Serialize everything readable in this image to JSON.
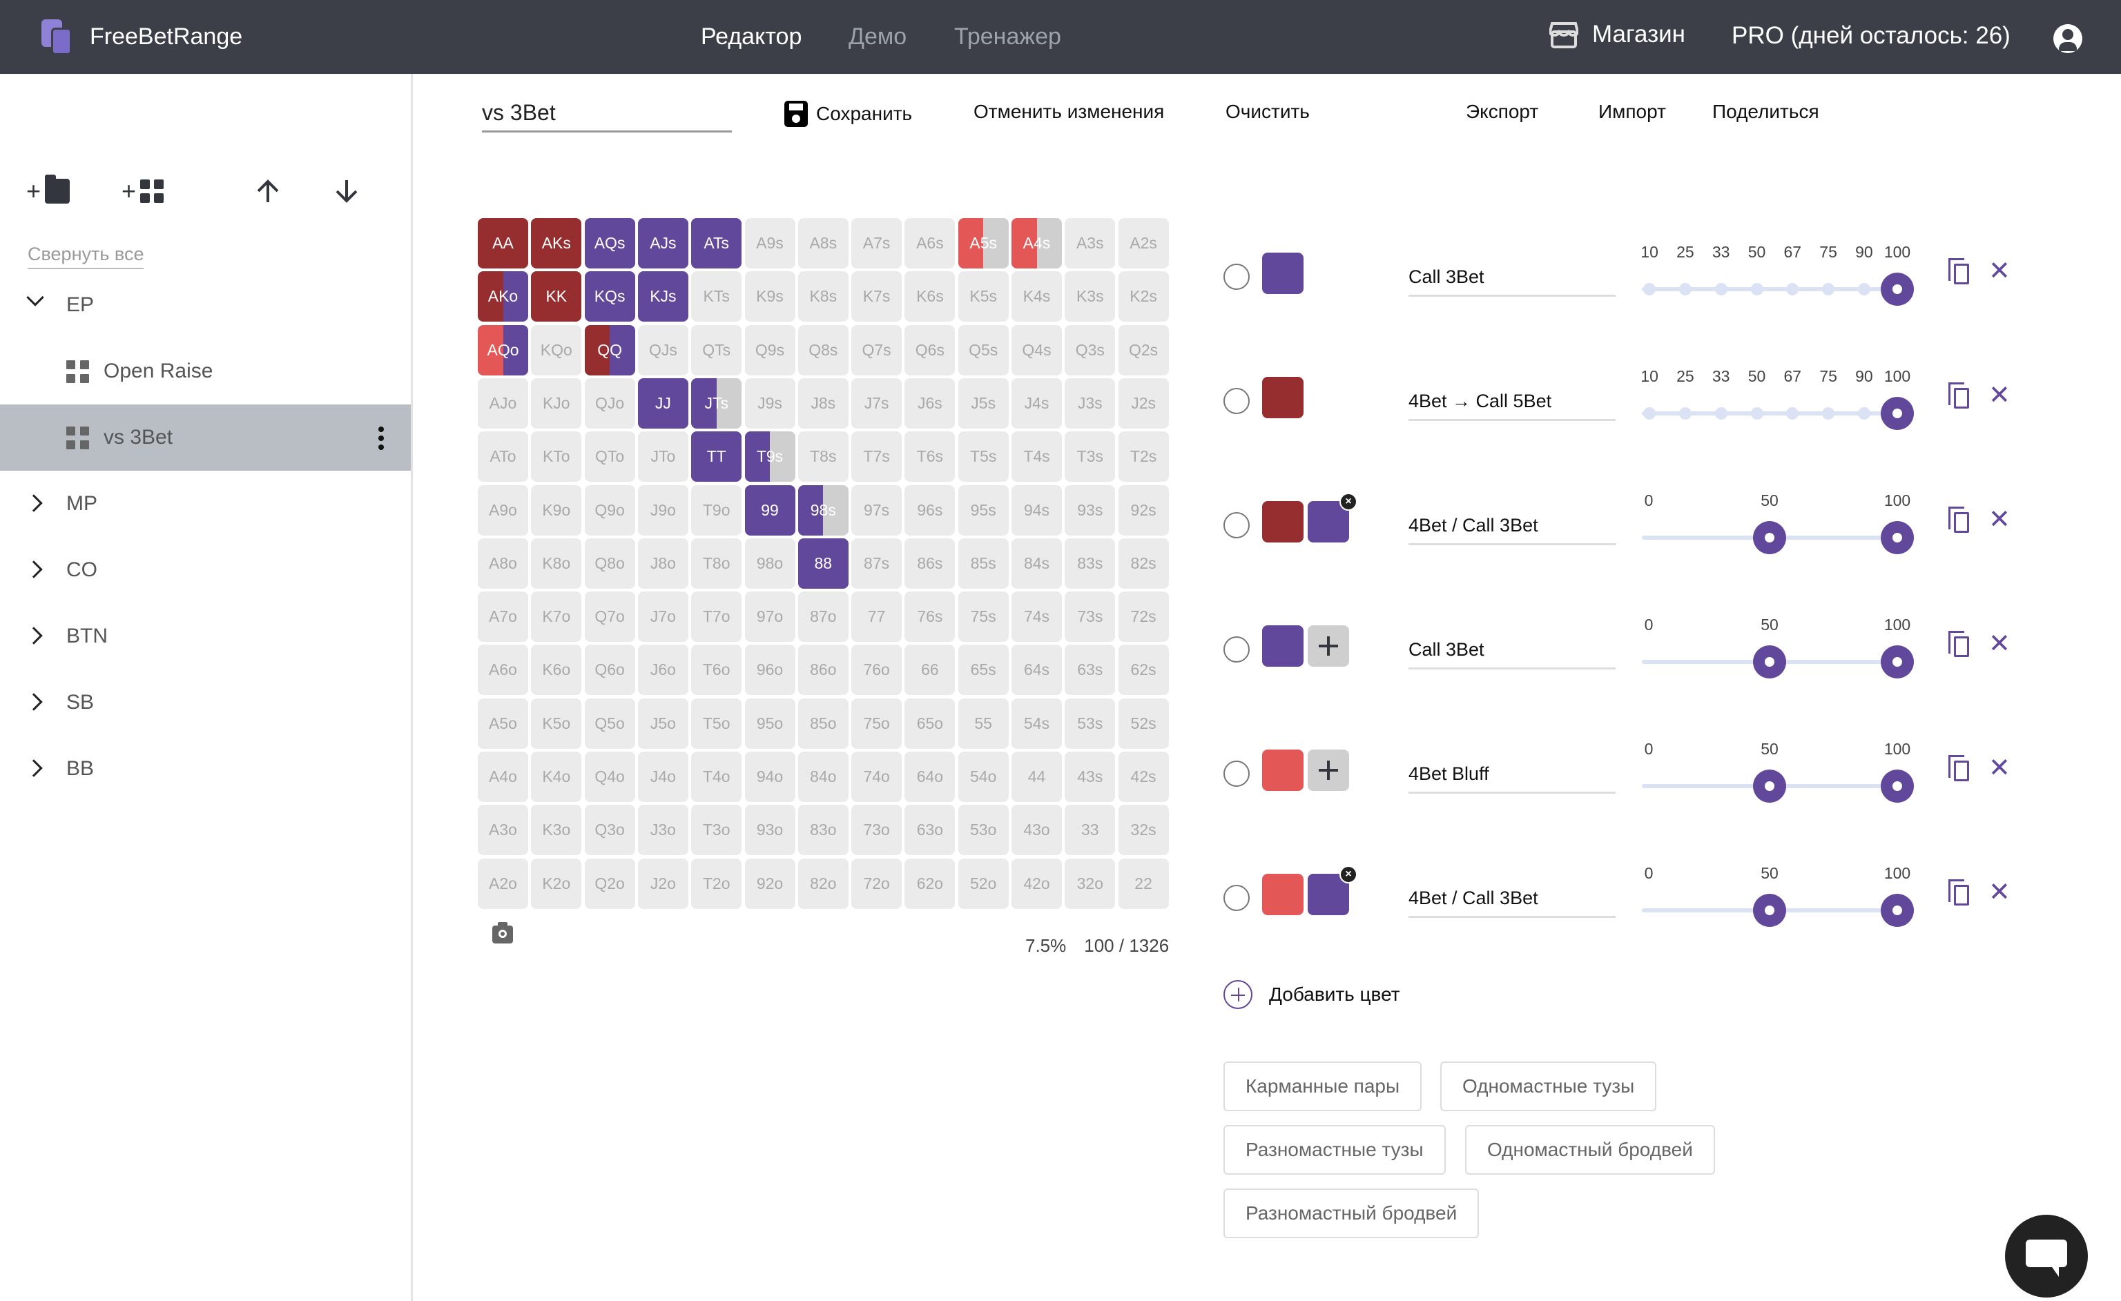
{
  "header": {
    "brand": "FreeBetRange",
    "nav": [
      {
        "label": "Редактор",
        "active": true
      },
      {
        "label": "Демо",
        "active": false
      },
      {
        "label": "Тренажер",
        "active": false
      }
    ],
    "shop_label": "Магазин",
    "pro_label": "PRO (дней осталось: 26)"
  },
  "sidebar": {
    "tools": {
      "add_folder": "+",
      "add_range": "+"
    },
    "collapse_all": "Свернуть все",
    "tree": [
      {
        "label": "EP",
        "expanded": true,
        "children": [
          {
            "label": "Open Raise",
            "selected": false
          },
          {
            "label": "vs 3Bet",
            "selected": true
          }
        ]
      },
      {
        "label": "MP",
        "expanded": false
      },
      {
        "label": "CO",
        "expanded": false
      },
      {
        "label": "BTN",
        "expanded": false
      },
      {
        "label": "SB",
        "expanded": false
      },
      {
        "label": "BB",
        "expanded": false
      }
    ]
  },
  "toolbar": {
    "range_name": "vs 3Bet",
    "save": "Сохранить",
    "revert": "Отменить изменения",
    "clear": "Очистить",
    "export": "Экспорт",
    "import": "Импорт",
    "share": "Поделиться"
  },
  "colors": {
    "purple": "#61489b",
    "darkred": "#962d2f",
    "red": "#e45757",
    "empty": "#ebebeb",
    "partial": "#cfcfcf"
  },
  "grid": {
    "ranks": [
      "A",
      "K",
      "Q",
      "J",
      "T",
      "9",
      "8",
      "7",
      "6",
      "5",
      "4",
      "3",
      "2"
    ],
    "highlighted": {
      "AA": [
        [
          "darkred",
          1
        ]
      ],
      "AKs": [
        [
          "darkred",
          1
        ]
      ],
      "AQs": [
        [
          "purple",
          1
        ]
      ],
      "AJs": [
        [
          "purple",
          1
        ]
      ],
      "ATs": [
        [
          "purple",
          1
        ]
      ],
      "A5s": [
        [
          "red",
          0.5
        ],
        [
          "partial",
          0.5
        ]
      ],
      "A4s": [
        [
          "red",
          0.5
        ],
        [
          "partial",
          0.5
        ]
      ],
      "AKo": [
        [
          "darkred",
          0.5
        ],
        [
          "purple",
          0.5
        ]
      ],
      "KK": [
        [
          "darkred",
          1
        ]
      ],
      "KQs": [
        [
          "purple",
          1
        ]
      ],
      "KJs": [
        [
          "purple",
          1
        ]
      ],
      "AQo": [
        [
          "red",
          0.5
        ],
        [
          "purple",
          0.5
        ]
      ],
      "QQ": [
        [
          "darkred",
          0.5
        ],
        [
          "purple",
          0.5
        ]
      ],
      "JJ": [
        [
          "purple",
          1
        ]
      ],
      "JTs": [
        [
          "purple",
          0.5
        ],
        [
          "partial",
          0.5
        ]
      ],
      "TT": [
        [
          "purple",
          1
        ]
      ],
      "T9s": [
        [
          "purple",
          0.5
        ],
        [
          "partial",
          0.5
        ]
      ],
      "99": [
        [
          "purple",
          1
        ]
      ],
      "98s": [
        [
          "purple",
          0.5
        ],
        [
          "partial",
          0.5
        ]
      ],
      "88": [
        [
          "purple",
          1
        ]
      ]
    }
  },
  "stats": {
    "percent": "7.5%",
    "combos": "100 / 1326"
  },
  "color_rows": [
    {
      "swatches": [
        "purple"
      ],
      "add": false,
      "name": "Call 3Bet",
      "slider": {
        "type": "steps",
        "labels": [
          "10",
          "25",
          "33",
          "50",
          "67",
          "75",
          "90",
          "100"
        ],
        "values": [
          100
        ]
      }
    },
    {
      "swatches": [
        "darkred"
      ],
      "add": false,
      "name": "4Bet → Call 5Bet",
      "slider": {
        "type": "steps",
        "labels": [
          "10",
          "25",
          "33",
          "50",
          "67",
          "75",
          "90",
          "100"
        ],
        "values": [
          100
        ]
      }
    },
    {
      "swatches": [
        "darkred",
        "purple"
      ],
      "add": false,
      "name": "4Bet / Call 3Bet",
      "slider": {
        "type": "split",
        "labels": [
          "0",
          "50",
          "100"
        ],
        "values": [
          50,
          100
        ]
      }
    },
    {
      "swatches": [
        "purple"
      ],
      "add": true,
      "name": "Call 3Bet",
      "slider": {
        "type": "split",
        "labels": [
          "0",
          "50",
          "100"
        ],
        "values": [
          50,
          100
        ]
      }
    },
    {
      "swatches": [
        "red"
      ],
      "add": true,
      "name": "4Bet Bluff",
      "slider": {
        "type": "split",
        "labels": [
          "0",
          "50",
          "100"
        ],
        "values": [
          50,
          100
        ]
      }
    },
    {
      "swatches": [
        "red",
        "purple"
      ],
      "add": false,
      "name": "4Bet / Call 3Bet",
      "slider": {
        "type": "split",
        "labels": [
          "0",
          "50",
          "100"
        ],
        "values": [
          50,
          100
        ]
      }
    }
  ],
  "add_color": "Добавить цвет",
  "presets": [
    "Карманные пары",
    "Одномастные тузы",
    "Разномастные тузы",
    "Одномастный бродвей",
    "Разномастный бродвей"
  ]
}
